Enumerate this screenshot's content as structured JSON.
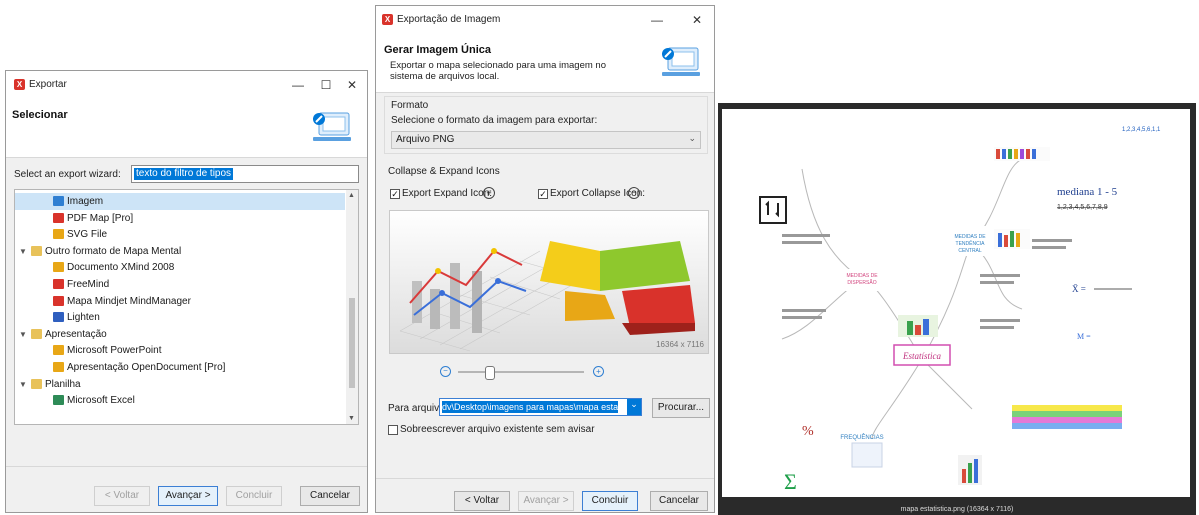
{
  "export_dialog": {
    "title": "Exportar",
    "heading": "Selecionar",
    "wizard_label": "Select an export wizard:",
    "filter_value": "texto do filtro de tipos",
    "tree": [
      {
        "label": "Imagem",
        "level": 2,
        "icon": "image-icon",
        "selected": true
      },
      {
        "label": "PDF Map [Pro]",
        "level": 2,
        "icon": "pdf-icon"
      },
      {
        "label": "SVG File",
        "level": 2,
        "icon": "svg-icon"
      },
      {
        "label": "Outro formato de Mapa Mental",
        "level": 1,
        "icon": "folder-icon"
      },
      {
        "label": "Documento XMind 2008",
        "level": 2,
        "icon": "xmind-icon"
      },
      {
        "label": "FreeMind",
        "level": 2,
        "icon": "freemind-icon"
      },
      {
        "label": "Mapa Mindjet MindManager",
        "level": 2,
        "icon": "mindmanager-icon"
      },
      {
        "label": "Lighten",
        "level": 2,
        "icon": "lighten-icon"
      },
      {
        "label": "Apresentação",
        "level": 1,
        "icon": "folder-icon"
      },
      {
        "label": "Microsoft PowerPoint",
        "level": 2,
        "icon": "powerpoint-icon"
      },
      {
        "label": "Apresentação OpenDocument [Pro]",
        "level": 2,
        "icon": "opendocument-icon"
      },
      {
        "label": "Planilha",
        "level": 1,
        "icon": "folder-icon"
      },
      {
        "label": "Microsoft Excel",
        "level": 2,
        "icon": "excel-icon"
      }
    ],
    "buttons": {
      "back": "< Voltar",
      "next": "Avançar >",
      "finish": "Concluir",
      "cancel": "Cancelar"
    }
  },
  "image_export_dialog": {
    "title": "Exportação de Imagem",
    "heading": "Gerar Imagem Única",
    "description": "Exportar o mapa selecionado para uma imagem no sistema de arquivos local.",
    "format_group": "Formato",
    "format_prompt": "Selecione o formato da imagem para exportar:",
    "format_value": "Arquivo PNG",
    "collapse_group": "Collapse & Expand Icons",
    "expand_label": "Export Expand Icon:",
    "collapse_label": "Export Collapse Icon:",
    "expand_checked": true,
    "collapse_checked": true,
    "preview_size": "16364 x 7116",
    "file_label": "Para arquivo:",
    "file_value": "dv\\Desktop\\imagens para mapas\\mapa estatistica.png",
    "browse": "Procurar...",
    "overwrite_label": "Sobreescrever arquivo existente sem avisar",
    "buttons": {
      "back": "< Voltar",
      "next": "Avançar >",
      "finish": "Concluir",
      "cancel": "Cancelar"
    }
  },
  "preview_image": {
    "caption": "mapa estatistica.png (16364 x 7116)",
    "center_node": "Estatística",
    "nodes": [
      "MEDIDAS DE TENDÊNCIA CENTRAL",
      "MEDIDAS DE DISPERSÃO",
      "FREQUÊNCIAS",
      "mediana 1 - 5",
      "DM ="
    ]
  },
  "colors": {
    "accent_blue": "#0078d7",
    "selection": "#cde4f7",
    "app_red": "#d9332b"
  }
}
